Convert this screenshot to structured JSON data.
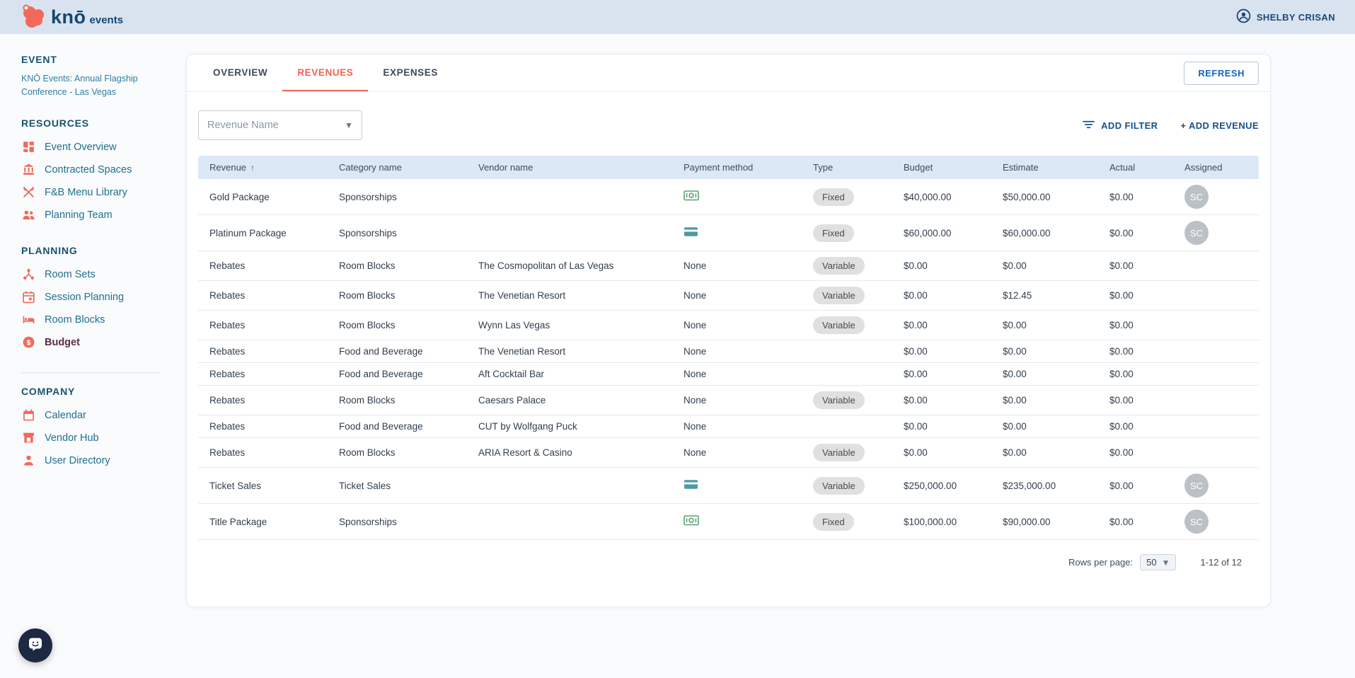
{
  "theme": {
    "accent_coral": "#f2695c",
    "navy": "#14486e",
    "sidebar_link": "#1f6f8e",
    "active_item_color": "#5b2d44",
    "table_header_bg": "#dce8f6",
    "action_blue": "#174f8f",
    "chip_bg": "#e0e0e0",
    "cash_green": "#58a173",
    "card_teal": "#4d9aa3"
  },
  "topbar": {
    "brand": {
      "logo_icon": "kno-logo-icon",
      "name": "knō",
      "suffix": "events"
    },
    "user": {
      "icon": "account-circle-icon",
      "name": "SHELBY CRISAN"
    }
  },
  "sidebar": {
    "sections": [
      {
        "heading": "EVENT",
        "subtitle": "KNŌ Events: Annual Flagship Conference - Las Vegas",
        "items": []
      },
      {
        "heading": "RESOURCES",
        "items": [
          {
            "label": "Event Overview",
            "icon": "dashboard-icon"
          },
          {
            "label": "Contracted Spaces",
            "icon": "building-icon"
          },
          {
            "label": "F&B Menu Library",
            "icon": "utensils-icon"
          },
          {
            "label": "Planning Team",
            "icon": "team-icon"
          }
        ]
      },
      {
        "heading": "PLANNING",
        "divider_after": true,
        "items": [
          {
            "label": "Room Sets",
            "icon": "hub-icon"
          },
          {
            "label": "Session Planning",
            "icon": "calendar-event-icon"
          },
          {
            "label": "Room Blocks",
            "icon": "bed-icon"
          },
          {
            "label": "Budget",
            "icon": "dollar-icon",
            "active": true
          }
        ]
      },
      {
        "heading": "COMPANY",
        "items": [
          {
            "label": "Calendar",
            "icon": "calendar-icon"
          },
          {
            "label": "Vendor Hub",
            "icon": "storefront-icon"
          },
          {
            "label": "User Directory",
            "icon": "person-icon"
          }
        ]
      }
    ]
  },
  "main": {
    "tabs": [
      {
        "label": "OVERVIEW",
        "active": false
      },
      {
        "label": "REVENUES",
        "active": true
      },
      {
        "label": "EXPENSES",
        "active": false
      }
    ],
    "refresh_button": "REFRESH",
    "filter_select": {
      "value": "Revenue Name",
      "icon": "chevron-down-icon"
    },
    "actions": {
      "add_filter": "ADD FILTER",
      "add_filter_icon": "filter-icon",
      "add_revenue": "+ ADD REVENUE"
    },
    "table": {
      "sort": {
        "column": "Revenue",
        "direction": "asc",
        "icon": "arrow-up-icon"
      },
      "columns": [
        "Revenue",
        "Category name",
        "Vendor name",
        "Payment method",
        "Type",
        "Budget",
        "Estimate",
        "Actual",
        "Assigned"
      ],
      "rows": [
        {
          "revenue": "Gold Package",
          "category": "Sponsorships",
          "vendor": "",
          "payment": "cash-icon",
          "type": "Fixed",
          "budget": "$40,000.00",
          "estimate": "$50,000.00",
          "actual": "$0.00",
          "assigned": "SC"
        },
        {
          "revenue": "Platinum Package",
          "category": "Sponsorships",
          "vendor": "",
          "payment": "credit-card-icon",
          "type": "Fixed",
          "budget": "$60,000.00",
          "estimate": "$60,000.00",
          "actual": "$0.00",
          "assigned": "SC"
        },
        {
          "revenue": "Rebates",
          "category": "Room Blocks",
          "vendor": "The Cosmopolitan of Las Vegas",
          "payment": "None",
          "type": "Variable",
          "budget": "$0.00",
          "estimate": "$0.00",
          "actual": "$0.00",
          "assigned": ""
        },
        {
          "revenue": "Rebates",
          "category": "Room Blocks",
          "vendor": "The Venetian Resort",
          "payment": "None",
          "type": "Variable",
          "budget": "$0.00",
          "estimate": "$12.45",
          "actual": "$0.00",
          "assigned": ""
        },
        {
          "revenue": "Rebates",
          "category": "Room Blocks",
          "vendor": "Wynn Las Vegas",
          "payment": "None",
          "type": "Variable",
          "budget": "$0.00",
          "estimate": "$0.00",
          "actual": "$0.00",
          "assigned": ""
        },
        {
          "revenue": "Rebates",
          "category": "Food and Beverage",
          "vendor": "The Venetian Resort",
          "payment": "None",
          "type": "",
          "budget": "$0.00",
          "estimate": "$0.00",
          "actual": "$0.00",
          "assigned": ""
        },
        {
          "revenue": "Rebates",
          "category": "Food and Beverage",
          "vendor": "Aft Cocktail Bar",
          "payment": "None",
          "type": "",
          "budget": "$0.00",
          "estimate": "$0.00",
          "actual": "$0.00",
          "assigned": ""
        },
        {
          "revenue": "Rebates",
          "category": "Room Blocks",
          "vendor": "Caesars Palace",
          "payment": "None",
          "type": "Variable",
          "budget": "$0.00",
          "estimate": "$0.00",
          "actual": "$0.00",
          "assigned": ""
        },
        {
          "revenue": "Rebates",
          "category": "Food and Beverage",
          "vendor": "CUT by Wolfgang Puck",
          "payment": "None",
          "type": "",
          "budget": "$0.00",
          "estimate": "$0.00",
          "actual": "$0.00",
          "assigned": ""
        },
        {
          "revenue": "Rebates",
          "category": "Room Blocks",
          "vendor": "ARIA Resort & Casino",
          "payment": "None",
          "type": "Variable",
          "budget": "$0.00",
          "estimate": "$0.00",
          "actual": "$0.00",
          "assigned": ""
        },
        {
          "revenue": "Ticket Sales",
          "category": "Ticket Sales",
          "vendor": "",
          "payment": "credit-card-icon",
          "type": "Variable",
          "budget": "$250,000.00",
          "estimate": "$235,000.00",
          "actual": "$0.00",
          "assigned": "SC"
        },
        {
          "revenue": "Title Package",
          "category": "Sponsorships",
          "vendor": "",
          "payment": "cash-icon",
          "type": "Fixed",
          "budget": "$100,000.00",
          "estimate": "$90,000.00",
          "actual": "$0.00",
          "assigned": "SC"
        }
      ]
    },
    "pagination": {
      "rows_per_page_label": "Rows per page:",
      "rows_per_page_value": "50",
      "range": "1-12 of 12"
    }
  },
  "chat_launcher": {
    "icon": "chat-smiley-icon"
  }
}
